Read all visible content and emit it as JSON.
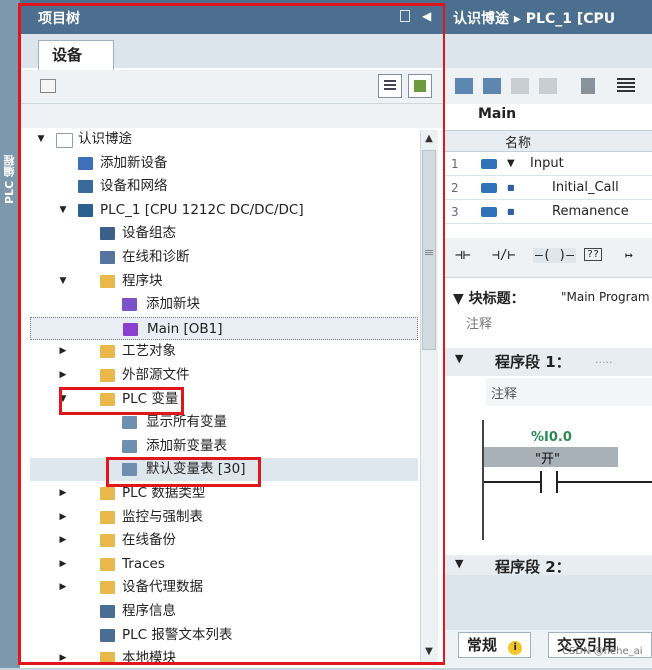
{
  "side_strip": {
    "label": "PLC 编程"
  },
  "project_tree": {
    "title": "项目树",
    "tab": "设备",
    "rows": [
      {
        "label": "认识博途",
        "indent": 0,
        "arrow": "▼",
        "icon": "project-icon",
        "color": "#ffffff"
      },
      {
        "label": "添加新设备",
        "indent": 1,
        "arrow": "",
        "icon": "add-device-icon",
        "color": "#3f6fb8"
      },
      {
        "label": "设备和网络",
        "indent": 1,
        "arrow": "",
        "icon": "network-icon",
        "color": "#3a6a9a"
      },
      {
        "label": "PLC_1 [CPU 1212C DC/DC/DC]",
        "indent": 1,
        "arrow": "▼",
        "icon": "cpu-icon",
        "color": "#2d5f8f"
      },
      {
        "label": "设备组态",
        "indent": 2,
        "arrow": "",
        "icon": "device-config-icon",
        "color": "#3a5f88"
      },
      {
        "label": "在线和诊断",
        "indent": 2,
        "arrow": "",
        "icon": "diagnostics-icon",
        "color": "#5575a0"
      },
      {
        "label": "程序块",
        "indent": 2,
        "arrow": "▼",
        "icon": "folder-icon",
        "color": "#e8b84a"
      },
      {
        "label": "添加新块",
        "indent": 3,
        "arrow": "",
        "icon": "add-block-icon",
        "color": "#7a52c9"
      },
      {
        "label": "Main [OB1]",
        "indent": 3,
        "arrow": "",
        "icon": "ob-icon",
        "color": "#8a3fd0"
      },
      {
        "label": "工艺对象",
        "indent": 2,
        "arrow": "▶",
        "icon": "folder-icon",
        "color": "#e8b84a"
      },
      {
        "label": "外部源文件",
        "indent": 2,
        "arrow": "▶",
        "icon": "folder-icon",
        "color": "#e8b84a"
      },
      {
        "label": "PLC 变量",
        "indent": 2,
        "arrow": "▼",
        "icon": "folder-icon",
        "color": "#e8b84a"
      },
      {
        "label": "显示所有变量",
        "indent": 3,
        "arrow": "",
        "icon": "tag-table-icon",
        "color": "#6f8fb0"
      },
      {
        "label": "添加新变量表",
        "indent": 3,
        "arrow": "",
        "icon": "add-tag-table-icon",
        "color": "#6f8fb0"
      },
      {
        "label": "默认变量表 [30]",
        "indent": 3,
        "arrow": "",
        "icon": "tag-table-icon",
        "color": "#6f8fb0"
      },
      {
        "label": "PLC 数据类型",
        "indent": 2,
        "arrow": "▶",
        "icon": "folder-icon",
        "color": "#e8b84a"
      },
      {
        "label": "监控与强制表",
        "indent": 2,
        "arrow": "▶",
        "icon": "folder-icon",
        "color": "#e8b84a"
      },
      {
        "label": "在线备份",
        "indent": 2,
        "arrow": "▶",
        "icon": "folder-icon",
        "color": "#e8b84a"
      },
      {
        "label": "Traces",
        "indent": 2,
        "arrow": "▶",
        "icon": "folder-icon",
        "color": "#e8b84a"
      },
      {
        "label": "设备代理数据",
        "indent": 2,
        "arrow": "▶",
        "icon": "folder-icon",
        "color": "#e8b84a"
      },
      {
        "label": "程序信息",
        "indent": 2,
        "arrow": "",
        "icon": "program-info-icon",
        "color": "#4a6d95"
      },
      {
        "label": "PLC 报警文本列表",
        "indent": 2,
        "arrow": "",
        "icon": "alarm-text-icon",
        "color": "#4a6d95"
      },
      {
        "label": "本地模块",
        "indent": 2,
        "arrow": "▶",
        "icon": "folder-icon",
        "color": "#e8b84a"
      }
    ]
  },
  "editor": {
    "breadcrumb": "认识博途 ▸ PLC_1 [CPU",
    "block_name": "Main",
    "interface_header": "名称",
    "interface_rows": [
      {
        "num": "1",
        "expander": "▼",
        "name": "Input"
      },
      {
        "num": "2",
        "expander": "■",
        "name": "Initial_Call"
      },
      {
        "num": "3",
        "expander": "■",
        "name": "Remanence"
      }
    ],
    "ladder_buttons": [
      "⊣⊢",
      "⊣/⊢",
      "–( )–",
      "??",
      "↦"
    ],
    "block_title_label": "▼ 块标题：",
    "block_title_value": "\"Main Program",
    "comment": "注释",
    "network1_label": "程序段 1：",
    "network1_dots": ".....",
    "network1_comment": "注释",
    "contact_address": "%I0.0",
    "contact_tag": "\"开\"",
    "network2_label": "程序段 2：",
    "bottom_tab_props": "常规",
    "bottom_tab_xref": "交叉引用",
    "info_icon": "i"
  },
  "watermark": "CSDN @hehe_ai"
}
